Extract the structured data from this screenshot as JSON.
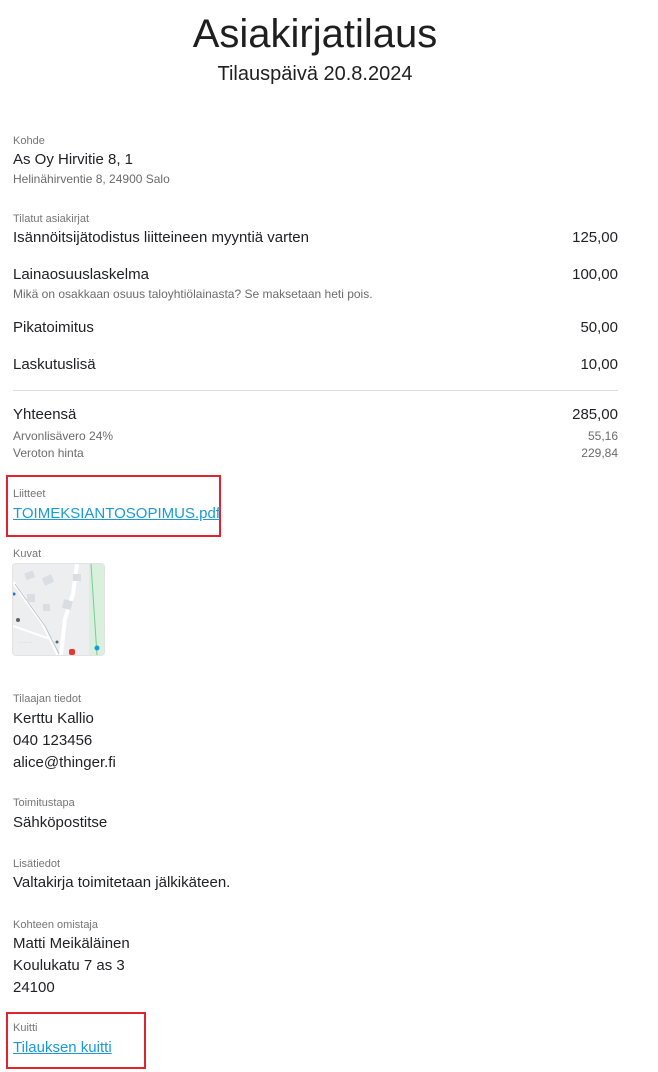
{
  "header": {
    "title": "Asiakirjatilaus",
    "subtitle": "Tilauspäivä 20.8.2024"
  },
  "property": {
    "label": "Kohde",
    "name": "As Oy Hirvitie 8, 1",
    "address": "Helinähirventie 8, 24900 Salo"
  },
  "ordered": {
    "label": "Tilatut asiakirjat",
    "items": [
      {
        "name": "Isännöitsijätodistus liitteineen myyntiä varten",
        "price": "125,00",
        "note": ""
      },
      {
        "name": "Lainaosuuslaskelma",
        "price": "100,00",
        "note": "Mikä on osakkaan osuus taloyhtiölainasta? Se maksetaan heti pois."
      },
      {
        "name": "Pikatoimitus",
        "price": "50,00",
        "note": ""
      },
      {
        "name": "Laskutuslisä",
        "price": "10,00",
        "note": ""
      }
    ]
  },
  "totals": {
    "total_label": "Yhteensä",
    "total_value": "285,00",
    "vat_label": "Arvonlisävero 24%",
    "vat_value": "55,16",
    "net_label": "Veroton hinta",
    "net_value": "229,84"
  },
  "attachments": {
    "label": "Liitteet",
    "file": "TOIMEKSIANTOSOPIMUS.pdf"
  },
  "images": {
    "label": "Kuvat",
    "thumbnail_icon": "map-thumbnail"
  },
  "orderer": {
    "label": "Tilaajan tiedot",
    "name": "Kerttu Kallio",
    "phone": "040 123456",
    "email": "alice@thinger.fi"
  },
  "delivery": {
    "label": "Toimitustapa",
    "value": "Sähköpostitse"
  },
  "extra": {
    "label": "Lisätiedot",
    "value": "Valtakirja toimitetaan jälkikäteen."
  },
  "owner": {
    "label": "Kohteen omistaja",
    "name": "Matti Meikäläinen",
    "street": "Koulukatu 7 as 3",
    "postal": "24100"
  },
  "receipt": {
    "label": "Kuitti",
    "link": "Tilauksen kuitti"
  },
  "colors": {
    "link": "#1a9ad6",
    "highlight": "#e0242f"
  }
}
